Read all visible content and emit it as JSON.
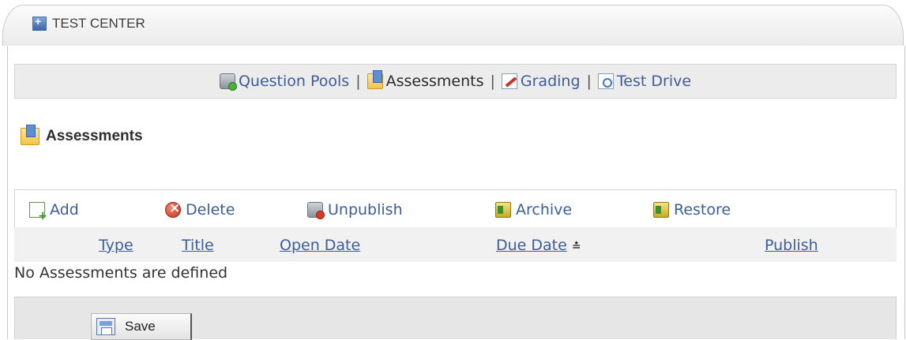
{
  "header": {
    "title": "TEST CENTER",
    "icon": "maximize-icon"
  },
  "nav": {
    "items": [
      {
        "label": "Question Pools",
        "icon": "question-pools-icon",
        "current": false
      },
      {
        "label": "Assessments",
        "icon": "assessments-folder-icon",
        "current": true
      },
      {
        "label": "Grading",
        "icon": "grading-icon",
        "current": false
      },
      {
        "label": "Test Drive",
        "icon": "test-drive-icon",
        "current": false
      }
    ],
    "separator": "|"
  },
  "section": {
    "title": "Assessments",
    "icon": "assessments-folder-icon"
  },
  "toolbar": {
    "add": "Add",
    "delete": "Delete",
    "unpublish": "Unpublish",
    "archive": "Archive",
    "restore": "Restore"
  },
  "table": {
    "columns": [
      "Type",
      "Title",
      "Open Date",
      "Due Date",
      "Publish"
    ],
    "sorted_column": "Due Date",
    "sort_indicator": "≛",
    "empty_message": "No Assessments are defined"
  },
  "footer": {
    "save_label": "Save"
  },
  "colors": {
    "link": "#3d5d99",
    "bar_bg": "#ececec",
    "border": "#d4d4d4"
  }
}
